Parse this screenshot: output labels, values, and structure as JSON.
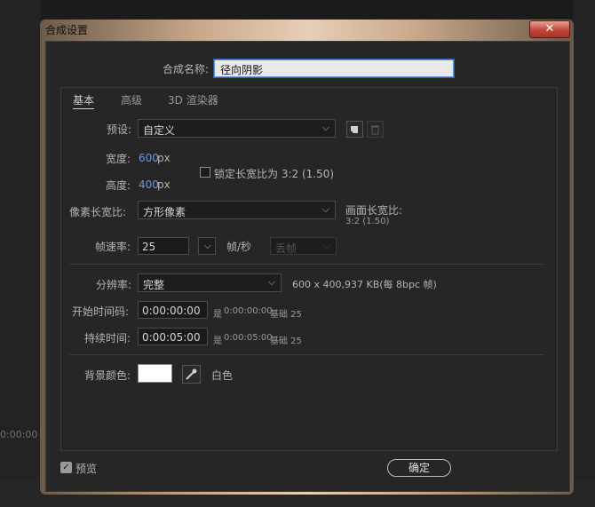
{
  "background": {
    "timecode": "0:00:00"
  },
  "dialog": {
    "title": "合成设置",
    "close_symbol": "✕",
    "comp_name_label": "合成名称:",
    "comp_name_value": "径向阴影",
    "tabs": [
      {
        "label": "基本",
        "active": true
      },
      {
        "label": "高级"
      },
      {
        "label": "3D 渲染器"
      }
    ],
    "preset": {
      "label": "预设:",
      "value": "自定义"
    },
    "width": {
      "label": "宽度:",
      "value": "600",
      "unit": "px"
    },
    "height": {
      "label": "高度:",
      "value": "400",
      "unit": "px"
    },
    "lock_ratio": {
      "label": "锁定长宽比为 3:2 (1.50)",
      "checked": false
    },
    "pixel_aspect": {
      "label": "像素长宽比:",
      "value": "方形像素"
    },
    "frame_aspect": {
      "label": "画面长宽比:",
      "value": "3:2 (1.50)"
    },
    "frame_rate": {
      "label": "帧速率:",
      "value": "25",
      "unit": "帧/秒",
      "drop_frame": "丢帧"
    },
    "resolution": {
      "label": "分辨率:",
      "value": "完整",
      "info": "600 x 400,937 KB(每 8bpc 帧)"
    },
    "start_timecode": {
      "label": "开始时间码:",
      "value": "0:00:00:00",
      "info_prefix": "是",
      "info_value": "0:00:00:00",
      "base": "基础 25"
    },
    "duration": {
      "label": "持续时间:",
      "value": "0:00:05:00",
      "info_prefix": "是",
      "info_value": "0:00:05:00",
      "base": "基础 25"
    },
    "bg_color": {
      "label": "背景颜色:",
      "swatch": "#ffffff",
      "name": "白色"
    },
    "preview": {
      "label": "预览",
      "checked": true
    },
    "ok_label": "确定"
  }
}
